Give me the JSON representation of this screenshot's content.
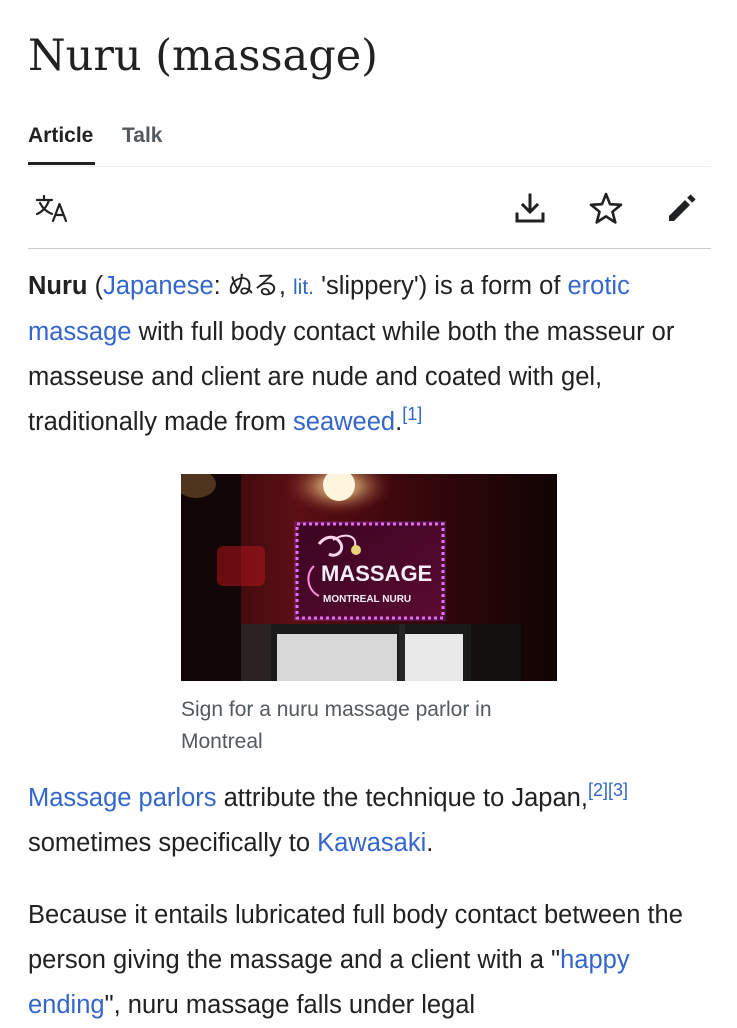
{
  "article": {
    "title": "Nuru (massage)"
  },
  "tabs": [
    {
      "label": "Article"
    },
    {
      "label": "Talk"
    }
  ],
  "toolbar": {
    "icons": [
      "translate-icon",
      "download-icon",
      "star-icon",
      "edit-pencil-icon"
    ]
  },
  "content": {
    "p1": {
      "term": "Nuru",
      "open_paren": " (",
      "lang_link": "Japanese",
      "colon": ": ",
      "native": "ぬる, ",
      "lit_link": "lit.",
      "gloss": " 'slippery') is a form of ",
      "erotic_link": "erotic massage",
      "rest": " with full body contact while both the masseur or masseuse and client are nude and coated with gel, traditionally made from ",
      "seaweed_link": "seaweed",
      "period": ".",
      "ref1": "[1]"
    },
    "figure": {
      "caption": "Sign for a nuru massage parlor in Montreal",
      "sign_main": "MASSAGE",
      "sign_sub": "MONTREAL NURU"
    },
    "p2": {
      "parlors_link": "Massage parlors",
      "text1": " attribute the technique to Japan,",
      "ref2": "[2]",
      "ref3": "[3]",
      "text2": " sometimes specifically to ",
      "kawasaki_link": "Kawasaki",
      "period": "."
    },
    "p3": {
      "text1": "Because it entails lubricated full body contact between the person giving the massage and a client with a \"",
      "happy_link": "happy ending",
      "text2": "\", nuru massage falls under legal"
    }
  },
  "colors": {
    "link": "#3366cc",
    "text": "#202122",
    "muted": "#54595d"
  }
}
